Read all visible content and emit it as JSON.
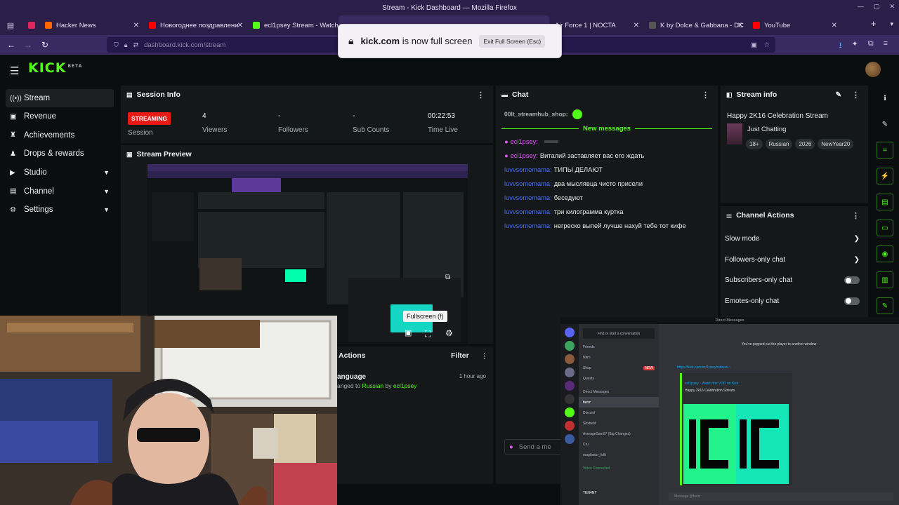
{
  "window": {
    "title": "Stream - Kick Dashboard — Mozilla Firefox"
  },
  "tabs": [
    {
      "label": "Hacker News",
      "color": "#ff6600"
    },
    {
      "label": "Новогоднее поздравлени",
      "color": "#ff0000"
    },
    {
      "label": "ecl1psey Stream - Watch Li",
      "color": "#53fc18"
    },
    {
      "label": "Air Force 1 | NOCTA",
      "color": "#222222"
    },
    {
      "label": "K by Dolce & Gabbana - DC",
      "color": "#333333"
    },
    {
      "label": "YouTube",
      "color": "#ff0000"
    }
  ],
  "url": {
    "host": "dashboard.kick.com",
    "path": "/stream"
  },
  "fullscreen_toast": {
    "domain": "kick.com",
    "message": "is now full screen",
    "exit_label": "Exit Full Screen (Esc)"
  },
  "brand": {
    "logo": "KICK",
    "beta": "BETA",
    "accent": "#53fc18"
  },
  "sidebar": {
    "items": [
      {
        "label": "Stream",
        "icon": "stream-icon"
      },
      {
        "label": "Revenue",
        "icon": "revenue-icon"
      },
      {
        "label": "Achievements",
        "icon": "trophy-icon"
      },
      {
        "label": "Drops & rewards",
        "icon": "gift-icon"
      },
      {
        "label": "Studio",
        "icon": "studio-icon"
      },
      {
        "label": "Channel",
        "icon": "channel-icon"
      },
      {
        "label": "Settings",
        "icon": "gear-icon"
      }
    ]
  },
  "session": {
    "title": "Session Info",
    "status": "STREAMING",
    "status_label": "Session",
    "viewers": "4",
    "viewers_label": "Viewers",
    "followers": "-",
    "followers_label": "Followers",
    "subs": "-",
    "subs_label": "Sub Counts",
    "time": "00:22:53",
    "time_label": "Time Live"
  },
  "preview": {
    "title": "Stream Preview",
    "tooltip": "Fullscreen (f)"
  },
  "actions": {
    "title": "Actions",
    "filter": "Filter",
    "item_title": "anguage",
    "item_pre": "anged to ",
    "item_value": "Russian",
    "item_by": " by ",
    "item_user": "ecl1psey",
    "item_time": "1 hour ago"
  },
  "chat": {
    "title": "Chat",
    "pinned_user": "00lt_streamhub_shop:",
    "new_messages": "New messages",
    "messages": [
      {
        "user": "ecl1psey:",
        "text": "",
        "color": "#e455ff"
      },
      {
        "user": "ecl1psey:",
        "text": "Виталий заставляет вас его ждать",
        "color": "#e455ff"
      },
      {
        "user": "luvvsomemama:",
        "text": "ТИПЫ ДЕЛАЮТ",
        "color": "#4a6bff"
      },
      {
        "user": "luvvsomemama:",
        "text": "два мыслявца чисто присели",
        "color": "#4a6bff"
      },
      {
        "user": "luvvsomemama:",
        "text": "беседуют",
        "color": "#4a6bff"
      },
      {
        "user": "luvvsomemama:",
        "text": "три килограмма куртка",
        "color": "#4a6bff"
      },
      {
        "user": "luvvsomemama:",
        "text": "негреско выпей лучше нахуй тебе тот кифе",
        "color": "#4a6bff"
      }
    ],
    "send_placeholder": "Send a me"
  },
  "stream_info": {
    "title": "Stream info",
    "stream_title": "Happy 2K16 Celebration Stream",
    "category": "Just Chatting",
    "tags": [
      "18+",
      "Russian",
      "2026",
      "NewYear20"
    ]
  },
  "channel_actions": {
    "title": "Channel Actions",
    "rows": [
      {
        "label": "Slow mode",
        "kind": "chevron"
      },
      {
        "label": "Followers-only chat",
        "kind": "chevron"
      },
      {
        "label": "Subscribers-only chat",
        "kind": "toggle"
      },
      {
        "label": "Emotes-only chat",
        "kind": "toggle"
      }
    ]
  },
  "discord": {
    "window_title": "Direct Messages",
    "search": "Find or start a conversation",
    "nav": [
      "Friends",
      "Nitro",
      "Shop",
      "Quests"
    ],
    "shop_badge": "NEW",
    "dm_header": "Direct Messages",
    "dms": [
      "benz",
      "Discord",
      "Sbxbebf",
      "AverageSam97 (Big Changes)",
      "Cru",
      "magibotor_fullt"
    ],
    "popped_out": "You've popped out the player to another window",
    "link": "https://kick.com/ecl1psey/videos/...",
    "embed_title": "ecl1psey - Watch the VOD on Kick",
    "embed_desc": "Happy 2k16 Celebration Stream",
    "voice_status": "Video Connected",
    "user": "TEN4NT",
    "composer": "Message @benz"
  }
}
